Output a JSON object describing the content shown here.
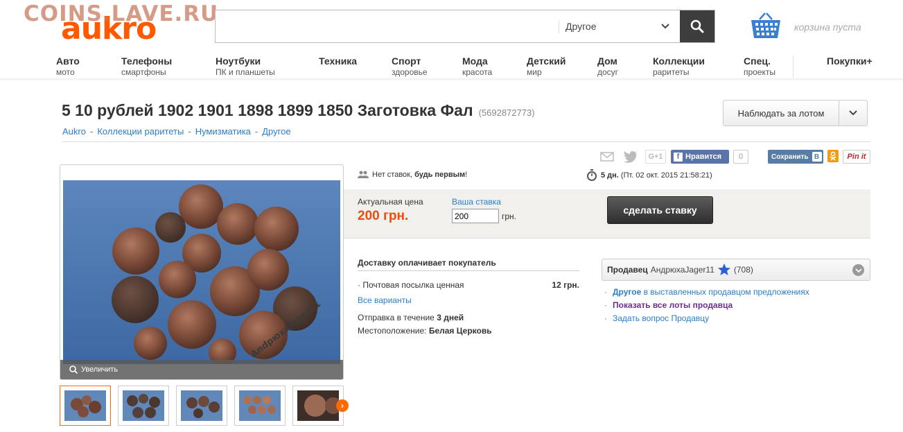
{
  "watermark": "COINS.LAVE.RU",
  "logo": "aukro",
  "search": {
    "placeholder": "",
    "category": "Другое"
  },
  "cart": {
    "text": "корзина пуста"
  },
  "nav": [
    {
      "main": "Авто",
      "sub": "мото"
    },
    {
      "main": "Телефоны",
      "sub": "смартфоны"
    },
    {
      "main": "Ноутбуки",
      "sub": "ПК и планшеты"
    },
    {
      "main": "Техника",
      "sub": ""
    },
    {
      "main": "Спорт",
      "sub": "здоровье"
    },
    {
      "main": "Мода",
      "sub": "красота"
    },
    {
      "main": "Детский",
      "sub": "мир"
    },
    {
      "main": "Дом",
      "sub": "досуг"
    },
    {
      "main": "Коллекции",
      "sub": "раритеты"
    },
    {
      "main": "Спец.",
      "sub": "проекты"
    },
    {
      "main": "Покупки+",
      "sub": ""
    }
  ],
  "lot": {
    "title": "5 10 рублей 1902 1901 1898 1899 1850 Заготовка Фал",
    "id": "(5692872773)",
    "watch_label": "Наблюдать за лотом"
  },
  "breadcrumb": [
    "Aukro",
    "Коллекции раритеты",
    "Нумизматика",
    "Другое"
  ],
  "social": {
    "like": "Нравится",
    "like_count": "0",
    "vk": "Сохранить",
    "vk_letter": "B",
    "pin": "Pin it",
    "ok": "ok",
    "gplus": "G+1"
  },
  "image": {
    "zoom": "Увеличить",
    "watermark_text": "AndpюхаJager11"
  },
  "bids": {
    "no_bids": "Нет ставок,",
    "be_first": "будь первым",
    "excl": "!"
  },
  "time": {
    "left": "5 дн.",
    "end": "(Пт. 02 окт. 2015 21:58:21)"
  },
  "price": {
    "label": "Актуальная цена",
    "value": "200 грн.",
    "stake_label": "Ваша ставка",
    "stake_value": "200",
    "stake_currency": "грн.",
    "bid_button": "сделать ставку"
  },
  "delivery": {
    "title": "Доставку оплачивает покупатель",
    "method": "· Почтовая посылка ценная",
    "cost": "12 грн.",
    "all_variants": "Все варианты",
    "ship_prefix": "Отправка в течение",
    "ship_value": "3 дней",
    "loc_prefix": "Местоположение:",
    "loc_value": "Белая Церковь"
  },
  "seller": {
    "label": "Продавец",
    "name": "АндрюхаJager11",
    "rating": "(708)",
    "link1_bold": "Другое",
    "link1_rest": "в выставленных продавцом предложениях",
    "link2": "Показать все лоты продавца",
    "link3": "Задать вопрос Продавцу"
  },
  "colors": {
    "accent": "#ff5a00",
    "price": "#e84e0f",
    "link": "#2a7dc9",
    "photo_bg": "#4f7bb2"
  }
}
